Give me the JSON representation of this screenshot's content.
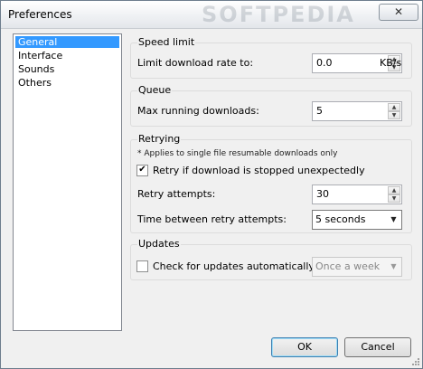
{
  "window": {
    "title": "Preferences",
    "watermark": "SOFTPEDIA",
    "close_glyph": "✕"
  },
  "nav": {
    "items": [
      "General",
      "Interface",
      "Sounds",
      "Others"
    ],
    "selected": "General"
  },
  "speed": {
    "group_title": "Speed limit",
    "label": "Limit download rate to:",
    "value": "0.0",
    "unit": "KB/s"
  },
  "queue": {
    "group_title": "Queue",
    "label": "Max running downloads:",
    "value": "5"
  },
  "retrying": {
    "group_title": "Retrying",
    "note": "* Applies to single file resumable downloads only",
    "retry_checkbox_label": "Retry if download is stopped unexpectedly",
    "retry_checked": true,
    "attempts_label": "Retry attempts:",
    "attempts_value": "30",
    "interval_label": "Time between retry attempts:",
    "interval_value": "5 seconds"
  },
  "updates": {
    "group_title": "Updates",
    "check_label": "Check for updates automatically",
    "checked": false,
    "frequency_value": "Once a week"
  },
  "footer": {
    "ok_label": "OK",
    "cancel_label": "Cancel"
  }
}
